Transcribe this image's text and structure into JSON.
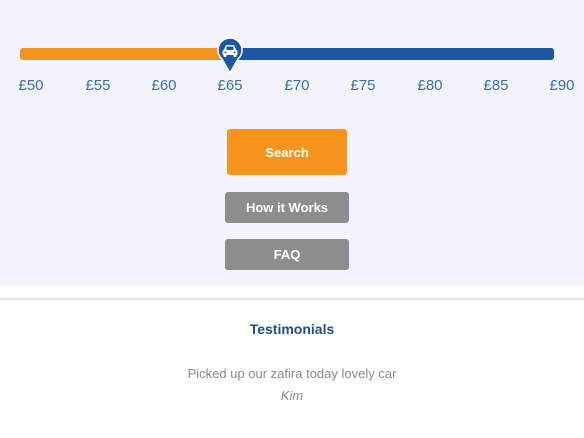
{
  "price_slider": {
    "min_label": "£50",
    "max_label": "£90",
    "selected_value": 65,
    "ticks": [
      "£50",
      "£55",
      "£60",
      "£65",
      "£70",
      "£75",
      "£80",
      "£85",
      "£90"
    ],
    "handle_icon": "car-icon",
    "colors": {
      "filled": "#f7941d",
      "remaining": "#1c57a4",
      "handle": "#1c57a4"
    }
  },
  "buttons": {
    "search_label": "Search",
    "how_it_works_label": "How it Works",
    "faq_label": "FAQ"
  },
  "testimonials": {
    "title": "Testimonials",
    "quote": "Picked up our zafira today lovely car",
    "author": "Kim"
  }
}
